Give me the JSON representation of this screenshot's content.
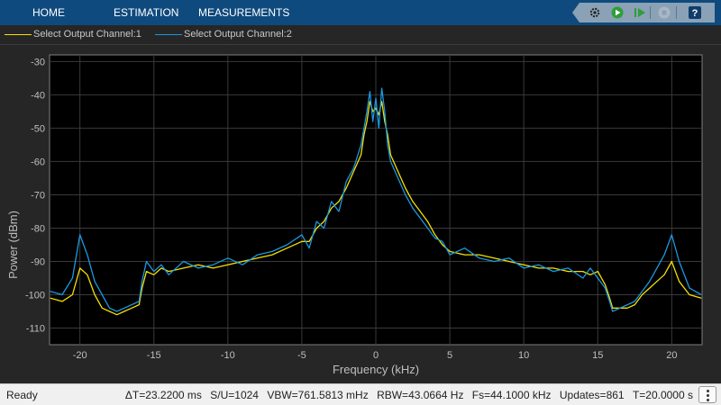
{
  "toolstrip": {
    "tabs": [
      "HOME",
      "ESTIMATION",
      "MEASUREMENTS"
    ],
    "buttons": [
      {
        "name": "settings-icon"
      },
      {
        "name": "run-icon"
      },
      {
        "name": "step-forward-icon"
      },
      {
        "name": "stop-icon"
      },
      {
        "name": "help-icon"
      }
    ],
    "colors": {
      "background": "#0e4a7d",
      "group": "#8aa1b6",
      "run": "#2e9e3b",
      "help": "#0f3d6b"
    }
  },
  "legend": {
    "items": [
      {
        "label": "Select Output Channel:1",
        "color": "#f5e000"
      },
      {
        "label": "Select Output Channel:2",
        "color": "#1b98e0"
      }
    ]
  },
  "chart_data": {
    "type": "line",
    "title": "",
    "xlabel": "Frequency (kHz)",
    "ylabel": "Power (dBm)",
    "xlim": [
      -22.05,
      22.05
    ],
    "ylim": [
      -115,
      -28
    ],
    "x_ticks": [
      -20,
      -15,
      -10,
      -5,
      0,
      5,
      10,
      15,
      20
    ],
    "y_ticks": [
      -30,
      -40,
      -50,
      -60,
      -70,
      -80,
      -90,
      -100,
      -110
    ],
    "grid": true,
    "legend_placement": "top",
    "series": [
      {
        "name": "Select Output Channel:1",
        "color": "#f5e000",
        "x": [
          -22,
          -21.2,
          -20.5,
          -20,
          -19.5,
          -19,
          -18.5,
          -18,
          -17.5,
          -17,
          -16.5,
          -16,
          -15.8,
          -15.5,
          -15,
          -14.5,
          -14,
          -13,
          -12,
          -11,
          -10,
          -9,
          -8,
          -7,
          -6,
          -5,
          -4.5,
          -4,
          -3.5,
          -3,
          -2.5,
          -2,
          -1.5,
          -1,
          -0.8,
          -0.6,
          -0.4,
          -0.2,
          0,
          0.2,
          0.4,
          0.6,
          0.8,
          1,
          1.5,
          2,
          2.5,
          3,
          3.5,
          4,
          4.5,
          5,
          6,
          7,
          8,
          9,
          10,
          11,
          12,
          13,
          14,
          14.5,
          15,
          15.5,
          15.8,
          16,
          16.5,
          17,
          17.5,
          18,
          18.5,
          19,
          19.5,
          20,
          20.5,
          21.2,
          22
        ],
        "y": [
          -101,
          -102,
          -100,
          -92,
          -94,
          -100,
          -104,
          -105,
          -106,
          -105,
          -104,
          -103,
          -98,
          -93,
          -94,
          -92,
          -93,
          -92,
          -91,
          -92,
          -91,
          -90,
          -89,
          -88,
          -86,
          -84,
          -84,
          -80,
          -78,
          -74,
          -72,
          -68,
          -63,
          -58,
          -52,
          -48,
          -42,
          -45,
          -44,
          -46,
          -42,
          -48,
          -52,
          -58,
          -63,
          -68,
          -72,
          -75,
          -78,
          -82,
          -85,
          -87,
          -88,
          -88,
          -89,
          -90,
          -91,
          -92,
          -92,
          -93,
          -93,
          -94,
          -93,
          -97,
          -101,
          -104,
          -104,
          -104,
          -103,
          -100,
          -98,
          -96,
          -94,
          -90,
          -96,
          -100,
          -101
        ]
      },
      {
        "name": "Select Output Channel:2",
        "color": "#1b98e0",
        "x": [
          -22,
          -21.2,
          -20.5,
          -20,
          -19.5,
          -19,
          -18.5,
          -18,
          -17.5,
          -17,
          -16.5,
          -16,
          -15.8,
          -15.5,
          -15,
          -14.5,
          -14,
          -13,
          -12,
          -11,
          -10,
          -9,
          -8,
          -7,
          -6,
          -5,
          -4.5,
          -4,
          -3.5,
          -3,
          -2.5,
          -2,
          -1.5,
          -1,
          -0.8,
          -0.6,
          -0.4,
          -0.2,
          0,
          0.2,
          0.4,
          0.6,
          0.8,
          1,
          1.5,
          2,
          2.5,
          3,
          3.5,
          4,
          4.5,
          5,
          6,
          7,
          8,
          9,
          10,
          11,
          12,
          13,
          14,
          14.5,
          15,
          15.5,
          15.8,
          16,
          16.5,
          17,
          17.5,
          18,
          18.5,
          19,
          19.5,
          20,
          20.5,
          21.2,
          22
        ],
        "y": [
          -99,
          -100,
          -95,
          -82,
          -88,
          -96,
          -100,
          -104,
          -105,
          -104,
          -103,
          -102,
          -96,
          -90,
          -93,
          -91,
          -94,
          -90,
          -92,
          -91,
          -89,
          -91,
          -88,
          -87,
          -85,
          -82,
          -86,
          -78,
          -80,
          -72,
          -75,
          -66,
          -62,
          -55,
          -50,
          -45,
          -39,
          -48,
          -41,
          -50,
          -38,
          -45,
          -55,
          -60,
          -65,
          -70,
          -74,
          -77,
          -80,
          -83,
          -84,
          -88,
          -86,
          -89,
          -90,
          -89,
          -92,
          -91,
          -93,
          -92,
          -95,
          -92,
          -95,
          -98,
          -102,
          -105,
          -104,
          -103,
          -102,
          -99,
          -96,
          -92,
          -88,
          -82,
          -90,
          -98,
          -100
        ]
      }
    ]
  },
  "statusbar": {
    "status": "Ready",
    "dt": "ΔT=23.2200 ms",
    "su": "S/U=1024",
    "vbw": "VBW=761.5813 mHz",
    "rbw": "RBW=43.0664 Hz",
    "fs": "Fs=44.1000 kHz",
    "updates": "Updates=861",
    "t": "T=20.0000 s"
  }
}
